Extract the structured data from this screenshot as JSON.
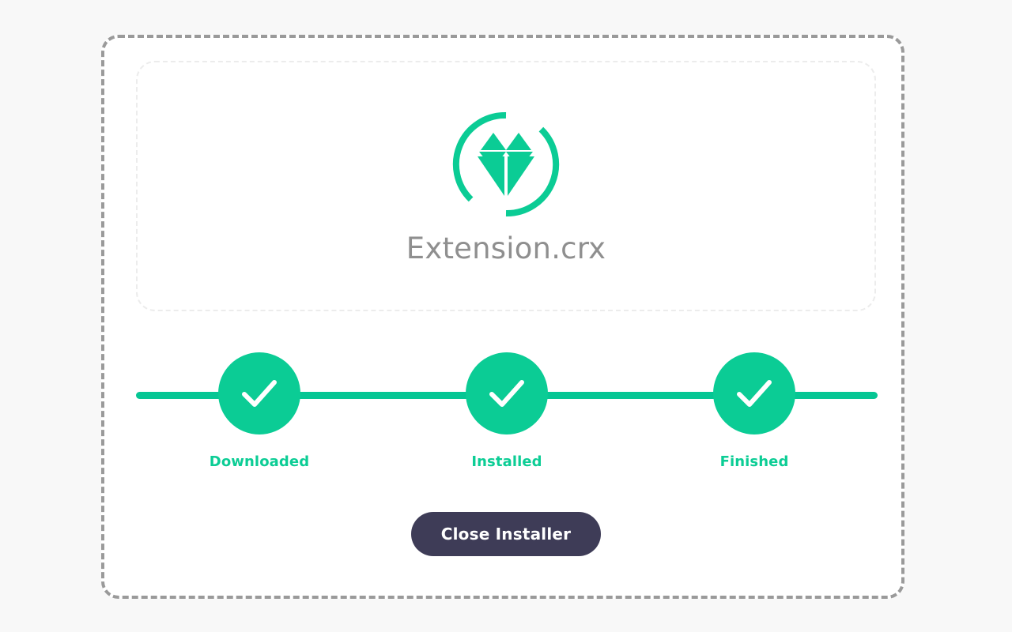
{
  "theme": {
    "page_background": "#f8f8f8",
    "card_background": "#ffffff",
    "accent_green": "#0bcc95",
    "line_green": "#06c694",
    "label_green": "#0ccd95",
    "button_background": "#3e3c57",
    "button_text": "#ffffff",
    "filename_text": "#8f8f8f",
    "dashed_border": "#9a9a9a",
    "dotted_border": "#ececec"
  },
  "file_card": {
    "logo_icon": "gem-in-broken-circle-icon",
    "file_name": "Extension.crx"
  },
  "stepper": {
    "check_icon": "check-icon",
    "steps": [
      {
        "label": "Downloaded",
        "state": "complete"
      },
      {
        "label": "Installed",
        "state": "complete"
      },
      {
        "label": "Finished",
        "state": "complete"
      }
    ]
  },
  "actions": {
    "close_label": "Close Installer"
  }
}
